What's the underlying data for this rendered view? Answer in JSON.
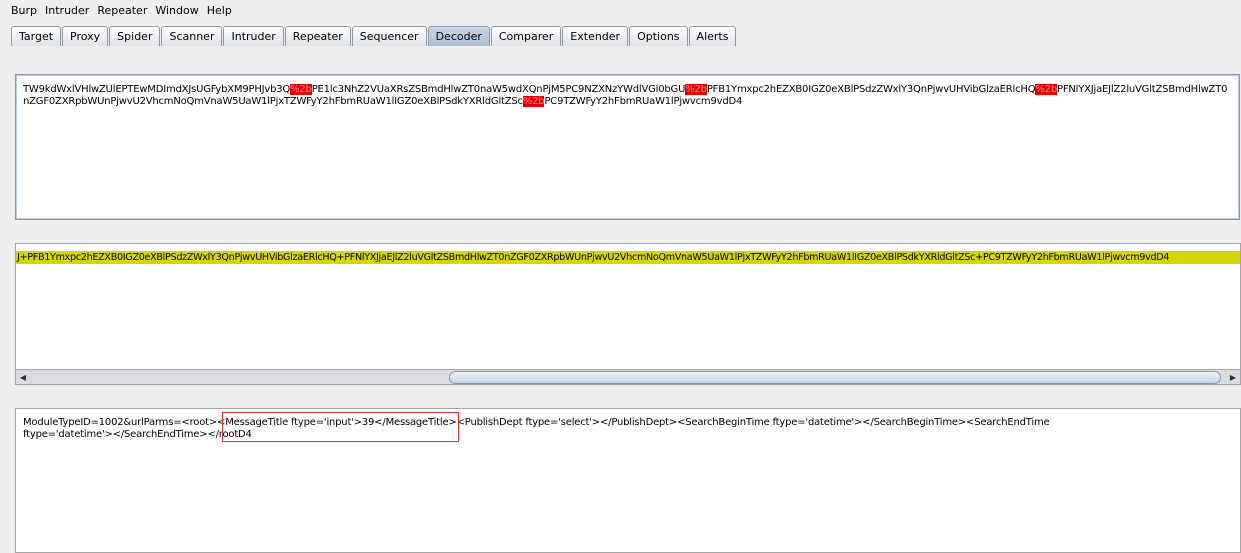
{
  "menu": [
    "Burp",
    "Intruder",
    "Repeater",
    "Window",
    "Help"
  ],
  "tabs": [
    {
      "label": "Target",
      "active": false
    },
    {
      "label": "Proxy",
      "active": false
    },
    {
      "label": "Spider",
      "active": false
    },
    {
      "label": "Scanner",
      "active": false
    },
    {
      "label": "Intruder",
      "active": false
    },
    {
      "label": "Repeater",
      "active": false
    },
    {
      "label": "Sequencer",
      "active": false
    },
    {
      "label": "Decoder",
      "active": true
    },
    {
      "label": "Comparer",
      "active": false
    },
    {
      "label": "Extender",
      "active": false
    },
    {
      "label": "Options",
      "active": false
    },
    {
      "label": "Alerts",
      "active": false
    }
  ],
  "decoder": {
    "input": {
      "segments": [
        {
          "text": "TW9kdWxlVHlwZUlEPTEwMDImdXJsUGFybXM9PHJvb3Q",
          "highlight": false
        },
        {
          "text": "%2b",
          "highlight": true
        },
        {
          "text": "PE1lc3NhZ2VUaXRsZSBmdHlwZT0naW5wdXQnPjM5PC9NZXNzYWdlVGl0bGU",
          "highlight": false
        },
        {
          "text": "%2b",
          "highlight": true
        },
        {
          "text": "PFB1Ymxpc2hEZXB0IGZ0eXBlPSdzZWxlY3QnPjwvUHVibGlzaERlcHQ",
          "highlight": false
        },
        {
          "text": "%2b",
          "highlight": true
        },
        {
          "text": "PFNlYXJjaEJlZ2luVGltZSBmdHlwZT0nZGF0ZXRpbWUnPjwvU2VhcmNoQmVnaW5UaW1lPjxTZWFyY2hFbmRUaW1lIGZ0eXBlPSdkYXRldGltZSc",
          "highlight": false
        },
        {
          "text": "%2b",
          "highlight": true
        },
        {
          "text": "PC9TZWFyY2hFbmRUaW1lPjwvcm9vdD4",
          "highlight": false
        }
      ]
    },
    "url_decoded": "J+PFB1Ymxpc2hEZXB0IGZ0eXBlPSdzZWxlY3QnPjwvUHVibGlzaERlcHQ+PFNlYXJjaEJlZ2luVGltZSBmdHlwZT0nZGF0ZXRpbWUnPjwvU2VhcmNoQmVnaW5UaW1lPjxTZWFyY2hFbmRUaW1lIGZ0eXBlPSdkYXRldGltZSc+PC9TZWFyY2hFbmRUaW1lPjwvcm9vdD4",
    "base64_decoded": {
      "line1": "ModuleTypeID=1002&urlParms=<root><MessageTitle ftype='input'>39</MessageTitle><PublishDept ftype='select'></PublishDept><SearchBeginTime ftype='datetime'></SearchBeginTime><SearchEndTime",
      "line2": "ftype='datetime'></SearchEndTime></rootD4"
    }
  },
  "colors": {
    "highlight_red": "#e60000",
    "highlight_yellow": "#d6d600",
    "annotation_box": "#e03030"
  }
}
